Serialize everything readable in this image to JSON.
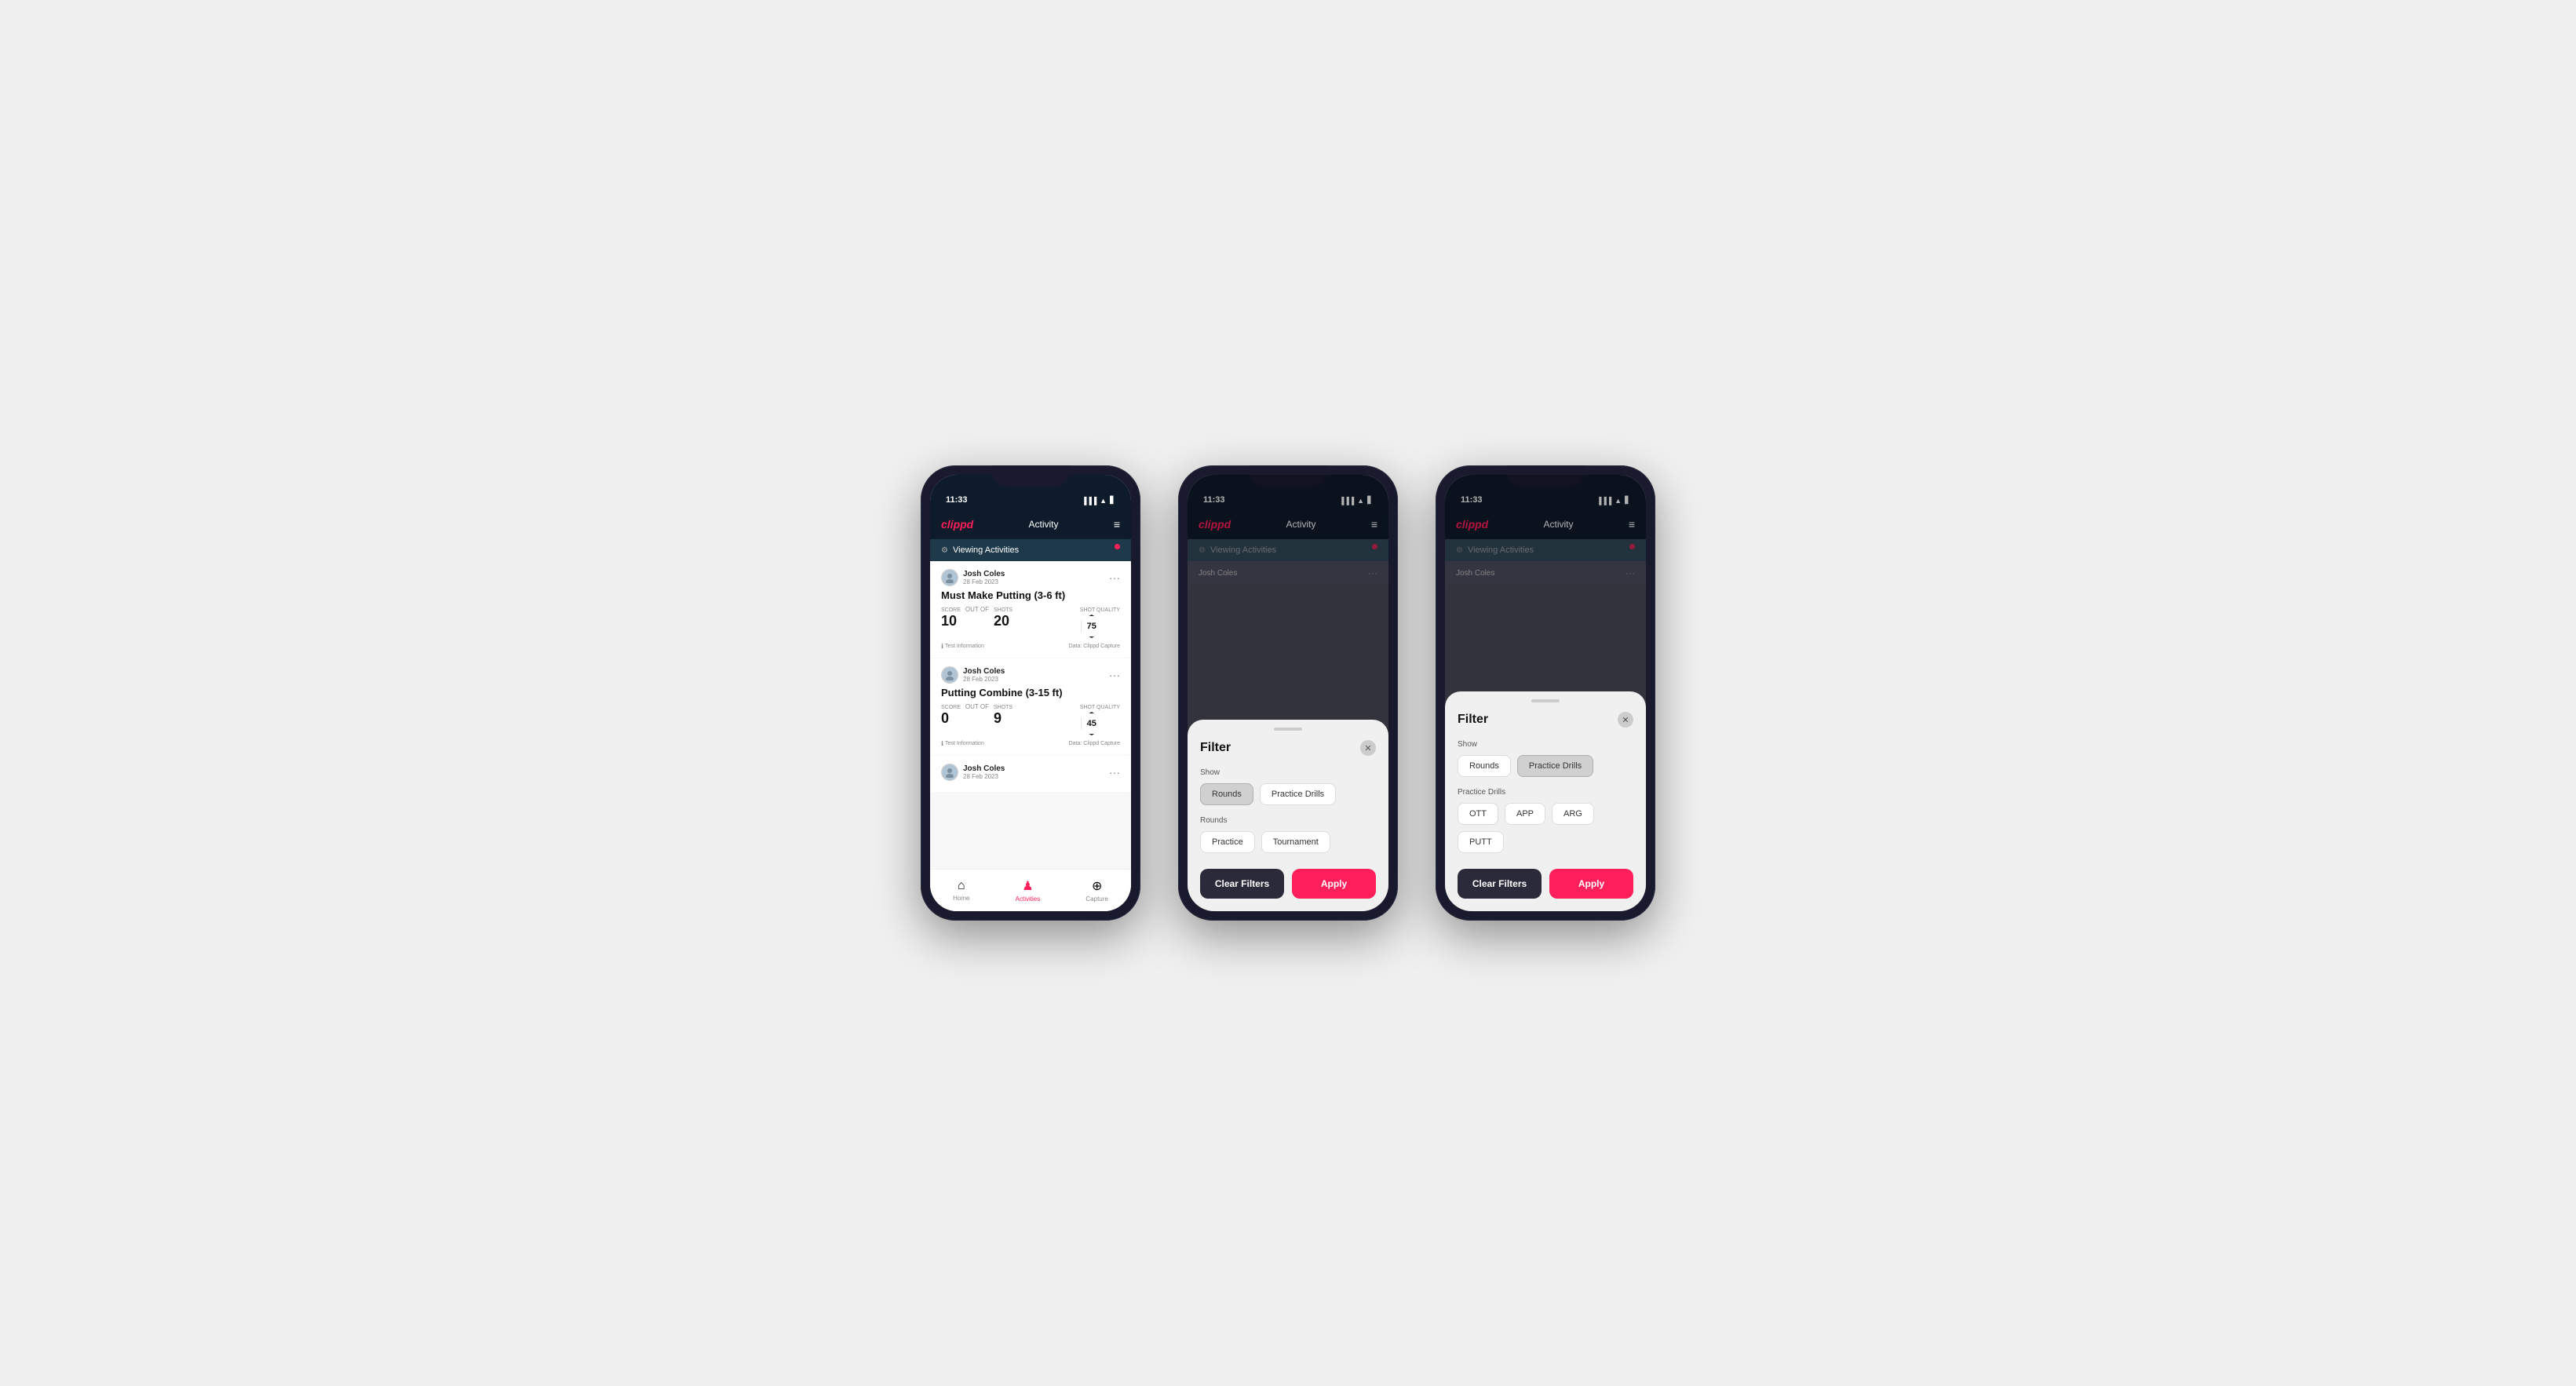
{
  "phones": [
    {
      "id": "phone1",
      "time": "11:33",
      "header": {
        "logo": "clippd",
        "title": "Activity",
        "menu": "≡"
      },
      "viewing_bar": "Viewing Activities",
      "activities": [
        {
          "user": "Josh Coles",
          "date": "28 Feb 2023",
          "title": "Must Make Putting (3-6 ft)",
          "score_label": "Score",
          "score": "10",
          "out_of": "OUT OF",
          "shots_label": "Shots",
          "shots": "20",
          "shot_quality_label": "Shot Quality",
          "shot_quality": "75",
          "info": "Test Information",
          "data": "Data: Clippd Capture"
        },
        {
          "user": "Josh Coles",
          "date": "28 Feb 2023",
          "title": "Putting Combine (3-15 ft)",
          "score_label": "Score",
          "score": "0",
          "out_of": "OUT OF",
          "shots_label": "Shots",
          "shots": "9",
          "shot_quality_label": "Shot Quality",
          "shot_quality": "45",
          "info": "Test Information",
          "data": "Data: Clippd Capture"
        },
        {
          "user": "Josh Coles",
          "date": "28 Feb 2023",
          "title": "",
          "score_label": "",
          "score": "",
          "out_of": "",
          "shots_label": "",
          "shots": "",
          "shot_quality_label": "",
          "shot_quality": "",
          "info": "",
          "data": ""
        }
      ],
      "nav": [
        {
          "label": "Home",
          "icon": "⌂",
          "active": false
        },
        {
          "label": "Activities",
          "icon": "♟",
          "active": true
        },
        {
          "label": "Capture",
          "icon": "⊕",
          "active": false
        }
      ]
    },
    {
      "id": "phone2",
      "time": "11:33",
      "header": {
        "logo": "clippd",
        "title": "Activity",
        "menu": "≡"
      },
      "viewing_bar": "Viewing Activities",
      "filter": {
        "title": "Filter",
        "show_label": "Show",
        "show_options": [
          {
            "label": "Rounds",
            "selected": true
          },
          {
            "label": "Practice Drills",
            "selected": false
          }
        ],
        "rounds_label": "Rounds",
        "rounds_options": [
          {
            "label": "Practice",
            "selected": false
          },
          {
            "label": "Tournament",
            "selected": false
          }
        ],
        "clear_label": "Clear Filters",
        "apply_label": "Apply"
      }
    },
    {
      "id": "phone3",
      "time": "11:33",
      "header": {
        "logo": "clippd",
        "title": "Activity",
        "menu": "≡"
      },
      "viewing_bar": "Viewing Activities",
      "filter": {
        "title": "Filter",
        "show_label": "Show",
        "show_options": [
          {
            "label": "Rounds",
            "selected": false
          },
          {
            "label": "Practice Drills",
            "selected": true
          }
        ],
        "practice_drills_label": "Practice Drills",
        "drills_options": [
          {
            "label": "OTT",
            "selected": false
          },
          {
            "label": "APP",
            "selected": false
          },
          {
            "label": "ARG",
            "selected": false
          },
          {
            "label": "PUTT",
            "selected": false
          }
        ],
        "clear_label": "Clear Filters",
        "apply_label": "Apply"
      }
    }
  ]
}
